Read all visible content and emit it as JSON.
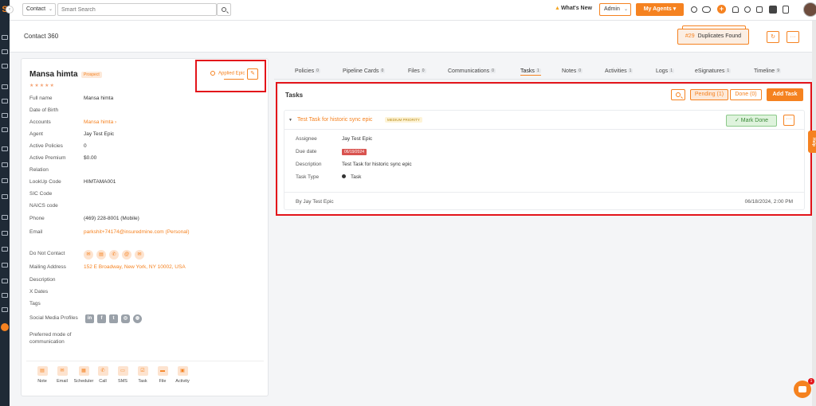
{
  "topbar": {
    "contact_select": "Contact",
    "search_placeholder": "Smart Search",
    "whats_new": "What's New",
    "admin_select": "Admin",
    "my_agents": "My Agents"
  },
  "header": {
    "title": "Contact 360",
    "duplicates_count": "#29",
    "duplicates_label": "Duplicates Found"
  },
  "contact": {
    "name": "Mansa himta",
    "badge": "Prospect",
    "stars": "★★★★★",
    "applied": "Applied Epic",
    "fields": [
      {
        "label": "Full name",
        "value": ""
      },
      {
        "label": "Date of Birth",
        "value": ""
      },
      {
        "label": "Accounts",
        "value": ""
      },
      {
        "label": "Agent",
        "value": "Jay Test Epic"
      },
      {
        "label": "Active Policies",
        "value": "0"
      },
      {
        "label": "Active Premium",
        "value": "$0.00"
      },
      {
        "label": "Relation",
        "value": ""
      },
      {
        "label": "LookUp Code",
        "value": "HIMTAMA001"
      },
      {
        "label": "SIC Code",
        "value": ""
      },
      {
        "label": "NAICS code",
        "value": ""
      },
      {
        "label": "Phone",
        "value": "(469) 228-8001 (Mobile)"
      },
      {
        "label": "Email",
        "value": "parkshit+74174@insuredmine.com (Personal)"
      }
    ],
    "full_name": "Mansa himta",
    "accounts_link": "Mansa himta ›",
    "do_not_contact": "Do Not Contact",
    "mailing_label": "Mailing Address",
    "mailing_value": "152 E Broadway, New York, NY 10002, USA",
    "description_label": "Description",
    "xdates_label": "X Dates",
    "tags_label": "Tags",
    "social_label": "Social Media Profiles",
    "preferred_label": "Preferred mode of communication",
    "actions": [
      "Note",
      "Email",
      "Scheduler",
      "Call",
      "SMS",
      "Task",
      "File",
      "Activity"
    ]
  },
  "tabs": [
    {
      "label": "Policies",
      "count": "0"
    },
    {
      "label": "Pipeline Cards",
      "count": "0"
    },
    {
      "label": "Files",
      "count": "0"
    },
    {
      "label": "Communications",
      "count": "0"
    },
    {
      "label": "Tasks",
      "count": "1"
    },
    {
      "label": "Notes",
      "count": "0"
    },
    {
      "label": "Activities",
      "count": "1"
    },
    {
      "label": "Logs",
      "count": "1"
    },
    {
      "label": "eSignatures",
      "count": "1"
    },
    {
      "label": "Timeline",
      "count": "9"
    }
  ],
  "tasks": {
    "title": "Tasks",
    "pending": "Pending (1)",
    "done": "Done (0)",
    "add": "Add Task",
    "card": {
      "title": "Test Task for historic sync epic",
      "priority": "MEDIUM PRIORITY",
      "mark_done": "Mark Done",
      "assignee_label": "Assignee",
      "assignee": "Jay Test Epic",
      "due_label": "Due date",
      "due": "06/19/2024",
      "desc_label": "Description",
      "desc": "Test Task for historic sync epic",
      "type_label": "Task Type",
      "type": "Task",
      "by": "By Jay Test Epic",
      "when": "06/18/2024, 2:00 PM"
    }
  },
  "help": "Help",
  "chat_badge": "1",
  "colors": {
    "accent": "#f58220",
    "highlight": "#e3141a",
    "sidebar": "#1f2a36"
  }
}
